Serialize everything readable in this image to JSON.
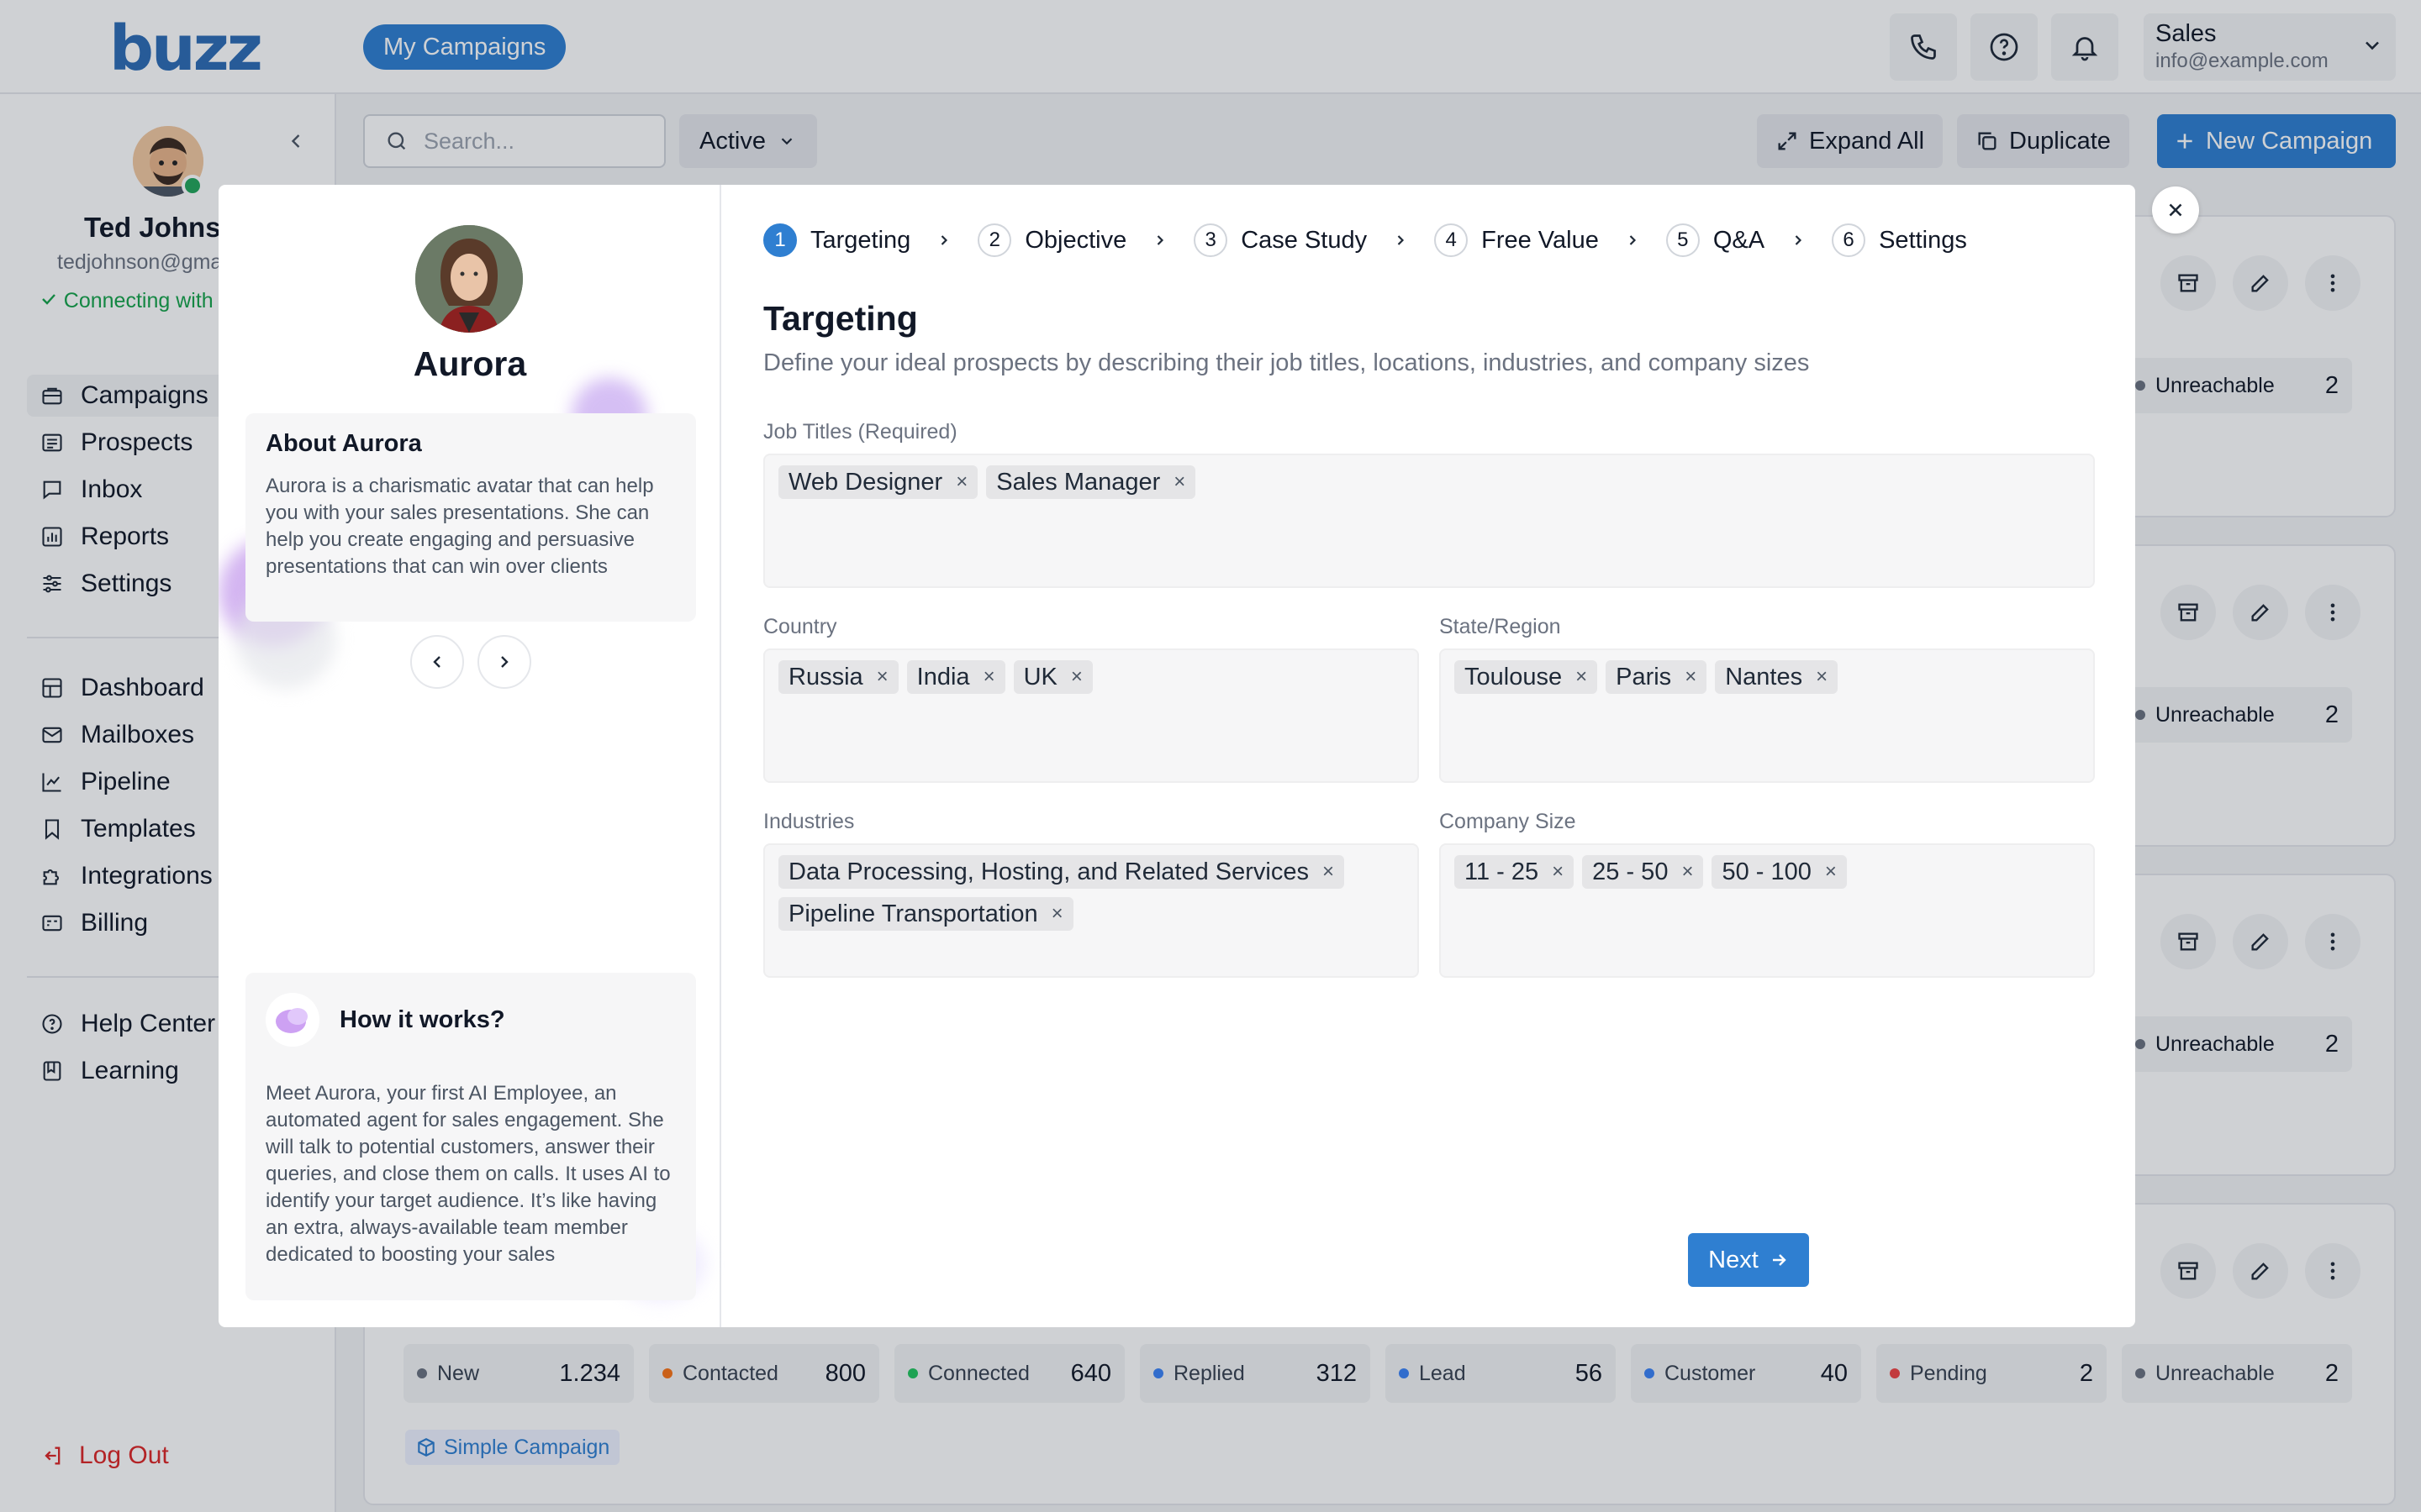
{
  "header": {
    "logo": "buzz",
    "nav_button": "My Campaigns",
    "user_menu": {
      "name": "Sales",
      "email": "info@example.com"
    }
  },
  "sidebar": {
    "user": {
      "name": "Ted Johns",
      "email": "tedjohnson@gma",
      "status": "Connecting with Venti"
    },
    "primary": [
      {
        "label": "Campaigns",
        "icon": "briefcase-icon"
      },
      {
        "label": "Prospects",
        "icon": "list-icon"
      },
      {
        "label": "Inbox",
        "icon": "inbox-icon"
      },
      {
        "label": "Reports",
        "icon": "bar-chart-icon"
      },
      {
        "label": "Settings",
        "icon": "sliders-icon"
      }
    ],
    "secondary": [
      {
        "label": "Dashboard",
        "icon": "dashboard-icon"
      },
      {
        "label": "Mailboxes",
        "icon": "mail-icon"
      },
      {
        "label": "Pipeline",
        "icon": "line-chart-icon"
      },
      {
        "label": "Templates",
        "icon": "bookmark-icon"
      },
      {
        "label": "Integrations",
        "icon": "puzzle-icon"
      },
      {
        "label": "Billing",
        "icon": "billing-icon"
      }
    ],
    "tertiary": [
      {
        "label": "Help Center",
        "icon": "help-icon"
      },
      {
        "label": "Learning",
        "icon": "book-icon"
      }
    ],
    "logout": "Log Out"
  },
  "toolbar": {
    "search_placeholder": "Search...",
    "status_filter": "Active",
    "expand_all": "Expand All",
    "duplicate": "Duplicate",
    "new_campaign": "New Campaign"
  },
  "cards": {
    "unreachable_label": "Unreachable",
    "unreachable_value": "2",
    "stats": [
      {
        "label": "New",
        "value": "1.234",
        "color": "#6b7280"
      },
      {
        "label": "Contacted",
        "value": "800",
        "color": "#f97316"
      },
      {
        "label": "Connected",
        "value": "640",
        "color": "#22c55e"
      },
      {
        "label": "Replied",
        "value": "312",
        "color": "#3b82f6"
      },
      {
        "label": "Lead",
        "value": "56",
        "color": "#3b82f6"
      },
      {
        "label": "Customer",
        "value": "40",
        "color": "#3b82f6"
      },
      {
        "label": "Pending",
        "value": "2",
        "color": "#ef4444"
      },
      {
        "label": "Unreachable",
        "value": "2",
        "color": "#6b7280"
      }
    ],
    "simple_campaign": "Simple Campaign"
  },
  "modal": {
    "avatar_name": "Aurora",
    "about_title": "About Aurora",
    "about_text": "Aurora is a charismatic avatar that can help you with your sales presentations. She can help you create engaging and persuasive presentations that can win over clients",
    "how_title": "How it works?",
    "how_text": "Meet Aurora, your first AI Employee, an automated agent for sales engagement. She will talk to potential customers, answer their queries, and close them on calls. It uses AI to identify your target audience. It’s like having an extra, always-available team member dedicated to boosting your sales",
    "steps": [
      {
        "num": "1",
        "label": "Targeting"
      },
      {
        "num": "2",
        "label": "Objective"
      },
      {
        "num": "3",
        "label": "Case Study"
      },
      {
        "num": "4",
        "label": "Free Value"
      },
      {
        "num": "5",
        "label": "Q&A"
      },
      {
        "num": "6",
        "label": "Settings"
      }
    ],
    "title": "Targeting",
    "subtitle": "Define your ideal prospects by describing their job titles, locations, industries, and company sizes",
    "fields": {
      "job_titles": {
        "label": "Job Titles (Required)",
        "tags": [
          "Web Designer",
          "Sales Manager"
        ]
      },
      "country": {
        "label": "Country",
        "tags": [
          "Russia",
          "India",
          "UK"
        ]
      },
      "state": {
        "label": "State/Region",
        "tags": [
          "Toulouse",
          "Paris",
          "Nantes"
        ]
      },
      "industries": {
        "label": "Industries",
        "tags": [
          "Data Processing, Hosting, and Related Services",
          "Pipeline Transportation"
        ]
      },
      "company_size": {
        "label": "Company Size",
        "tags": [
          "11 - 25",
          "25 - 50",
          "50 - 100"
        ]
      }
    },
    "next": "Next",
    "tag_remove": "×"
  },
  "colors": {
    "primary": "#2f7fd1",
    "success": "#16a34a",
    "danger": "#dc2626"
  }
}
